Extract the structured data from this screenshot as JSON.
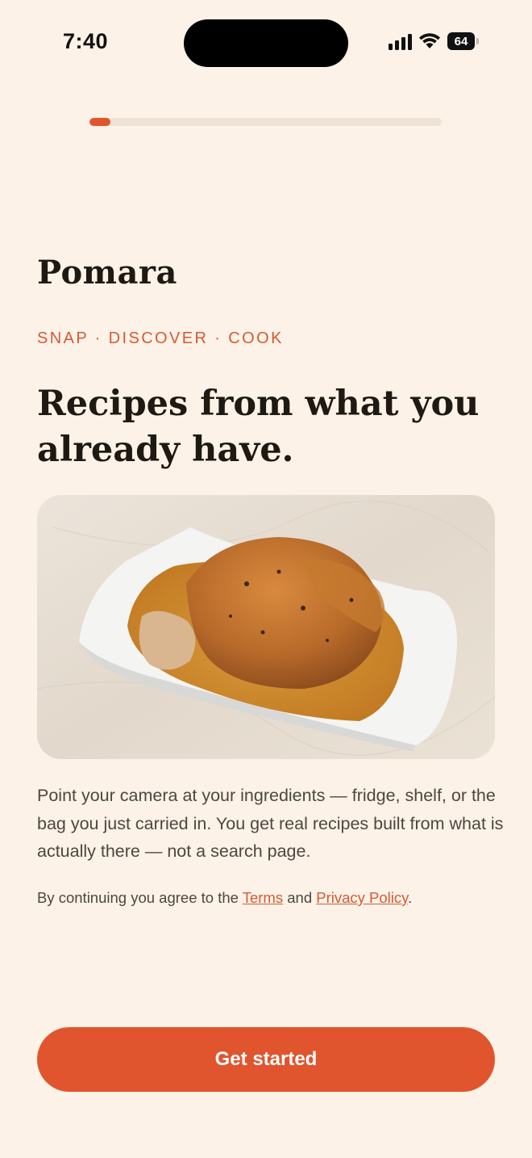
{
  "status_bar": {
    "time": "7:40",
    "battery_level": "64",
    "icons": [
      "signal-icon",
      "wifi-icon",
      "battery-icon"
    ]
  },
  "onboarding_progress": {
    "step": 1,
    "fraction": 0.06
  },
  "brand": {
    "name": "Pomara"
  },
  "tagline": "SNAP · DISCOVER · COOK",
  "headline": "Recipes from what you already have.",
  "hero_image": {
    "subject": "roast chicken on a white serving dish"
  },
  "description": "Point your camera at your ingredients — fridge, shelf, or the bag you just carried in. You get real recipes built from what is actually there — not a search page.",
  "legal": {
    "prefix": "By continuing you agree to the ",
    "terms_label": "Terms",
    "connector": " and ",
    "privacy_label": "Privacy Policy",
    "suffix": "."
  },
  "cta": {
    "label": "Get started"
  },
  "colors": {
    "background": "#fcf2e7",
    "accent": "#e0552d",
    "text": "#1e1913",
    "muted_text": "#4d4740"
  }
}
